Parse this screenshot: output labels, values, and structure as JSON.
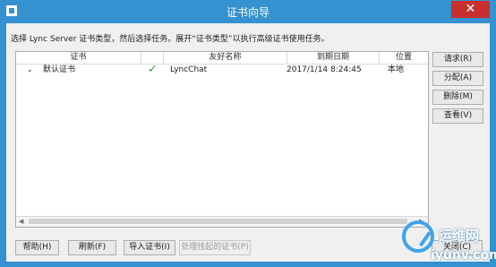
{
  "window": {
    "title": "证书向导",
    "close": "✕"
  },
  "instruction": "选择 Lync Server 证书类型，然后选择任务。展开“证书类型”以执行高级证书使用任务。",
  "table": {
    "columns": [
      "证书",
      "",
      "友好名称",
      "到期日期",
      "位置"
    ],
    "rows": [
      {
        "expand": "⌄",
        "cert": "默认证书",
        "status": "✓",
        "friendly": "LyncChat",
        "expiry": "2017/1/14 8:24:45",
        "location": "本地"
      }
    ]
  },
  "side_buttons": [
    "请求(R)",
    "分配(A)",
    "删除(M)",
    "查看(V)"
  ],
  "footer_buttons": [
    "帮助(H)",
    "刷新(F)",
    "导入证书(I)",
    "处理挂起的证书(P)",
    "关闭(C)"
  ],
  "scroll": {
    "left": "◀",
    "right": "▶"
  },
  "watermark": {
    "title": "运维网",
    "url": "iyunv.com"
  },
  "colors": {
    "title_bar": "#3591d0",
    "close": "#c7302f",
    "check": "#2f9b2f"
  }
}
